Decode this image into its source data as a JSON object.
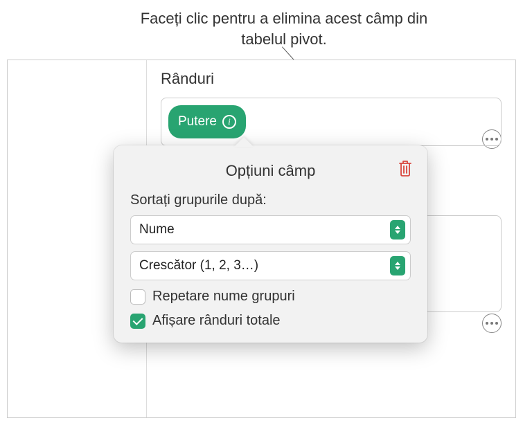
{
  "callout": {
    "text": "Faceți clic pentru a elimina acest câmp din tabelul pivot."
  },
  "sidebar": {
    "sectionTitle": "Rânduri",
    "pill": {
      "label": "Putere"
    }
  },
  "popover": {
    "title": "Opțiuni câmp",
    "sortLabel": "Sortați grupurile după:",
    "sortBy": "Nume",
    "sortOrder": "Crescător (1, 2, 3…)",
    "repeatGroups": {
      "label": "Repetare nume grupuri",
      "checked": false
    },
    "showTotals": {
      "label": "Afișare rânduri totale",
      "checked": true
    }
  }
}
